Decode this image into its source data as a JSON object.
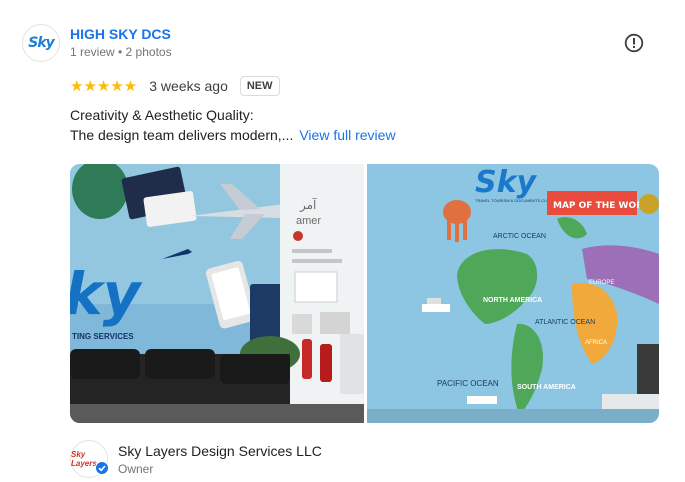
{
  "reviewer": {
    "avatar_text": "Sky",
    "name": "HIGH SKY DCS",
    "meta": "1 review • 2 photos"
  },
  "rating": {
    "stars": "★★★★★",
    "value": 5,
    "time": "3 weeks ago",
    "badge": "NEW"
  },
  "review": {
    "line1": "Creativity & Aesthetic Quality:",
    "line2": "The design team delivers modern,...",
    "view_full": "View full review"
  },
  "photos": {
    "left": {
      "logo_text": "ky",
      "logo_sub": "TING SERVICES",
      "sign_arabic": "آمر",
      "sign_latin": "amer"
    },
    "right": {
      "logo_text": "Sky",
      "logo_sub": "TRAVEL TOURISM & DOCUMENTS CLEARING SERVICES",
      "banner": "MAP OF THE WORLD",
      "arctic": "ARCTIC OCEAN",
      "north_america": "NORTH AMERICA",
      "atlantic": "ATLANTIC OCEAN",
      "south_america": "SOUTH AMERICA",
      "pacific": "PACIFIC OCEAN",
      "europe": "EUROPE",
      "africa": "AFRICA"
    }
  },
  "owner": {
    "avatar_text": "Sky Layers",
    "name": "Sky Layers Design Services LLC",
    "role": "Owner"
  },
  "colors": {
    "link": "#1a73e8",
    "star": "#fbbc04",
    "wall": "#8fc3de",
    "banner": "#e94b3c"
  },
  "icons": {
    "report": "report-icon",
    "verified": "verified-check-icon"
  }
}
